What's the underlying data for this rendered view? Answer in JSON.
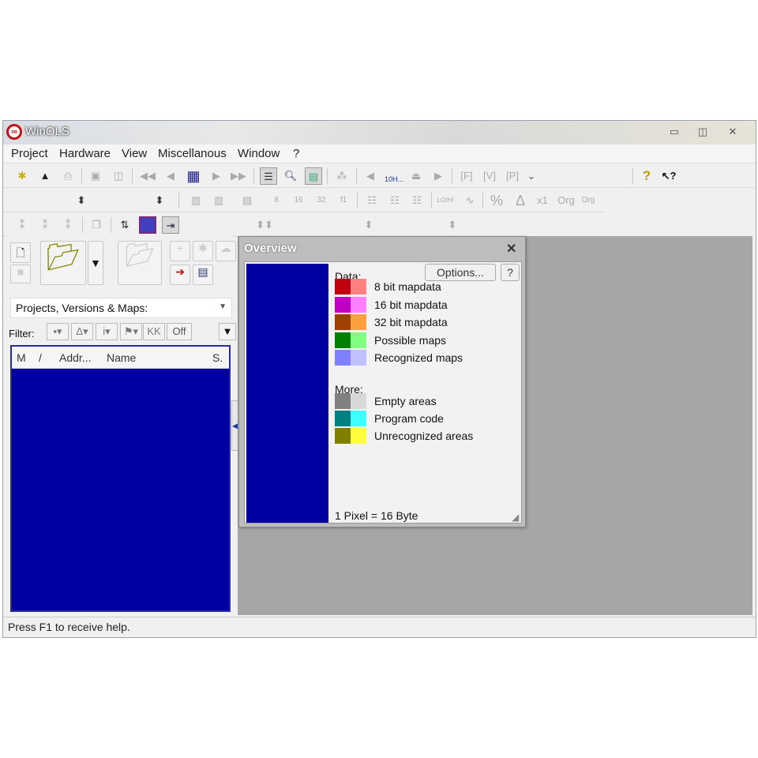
{
  "window": {
    "title": "WinOLS",
    "controls": [
      "minimize",
      "restore",
      "close"
    ]
  },
  "menu": [
    "Project",
    "Hardware",
    "View",
    "Miscellanous",
    "Window",
    "?"
  ],
  "toolbar": {
    "row1_icons": [
      "project-wizard-icon",
      "hardware-icon",
      "print-icon",
      "copy-icon",
      "compare-icon",
      "first-icon",
      "prev-icon",
      "grid-icon",
      "next-icon",
      "last-icon",
      "list-view-icon",
      "search-view-icon",
      "map-view-icon",
      "scatter-icon",
      "left-icon",
      "find-binoculars-icon",
      "find-next-icon",
      "right-icon",
      "f-icon",
      "v-icon",
      "p-icon",
      "dropdown-icon",
      "help-icon",
      "context-help-icon"
    ],
    "row2_labels": [
      "8",
      "16",
      "32",
      "f1",
      "LO/HI",
      "%",
      "x1",
      "Org",
      "Org"
    ],
    "search_label": "10H..."
  },
  "left": {
    "combo": "Projects, Versions & Maps:",
    "filter_label": "Filter:",
    "filter_off": "Off",
    "filter_kk": "KK",
    "columns": [
      "M",
      "/",
      "Addr...",
      "Name",
      "S."
    ]
  },
  "overview": {
    "title": "Overview",
    "options_button": "Options...",
    "help_button": "?",
    "data_label": "Data:",
    "more_label": "More:",
    "data_items": [
      {
        "label": "8 bit mapdata",
        "c1": "#c00010",
        "c2": "#ff8080"
      },
      {
        "label": "16 bit mapdata",
        "c1": "#c000c0",
        "c2": "#ff80ff"
      },
      {
        "label": "32 bit mapdata",
        "c1": "#a04000",
        "c2": "#ffa040"
      },
      {
        "label": "Possible maps",
        "c1": "#008000",
        "c2": "#80ff80"
      },
      {
        "label": "Recognized maps",
        "c1": "#8080ff",
        "c2": "#c0c0ff"
      }
    ],
    "more_items": [
      {
        "label": "Empty areas",
        "c1": "#808080",
        "c2": "#d8d8d8"
      },
      {
        "label": "Program code",
        "c1": "#008080",
        "c2": "#40ffff"
      },
      {
        "label": "Unrecognized areas",
        "c1": "#808000",
        "c2": "#ffff40"
      }
    ],
    "scale": "1 Pixel = 16 Byte"
  },
  "status": "Press F1 to receive help."
}
